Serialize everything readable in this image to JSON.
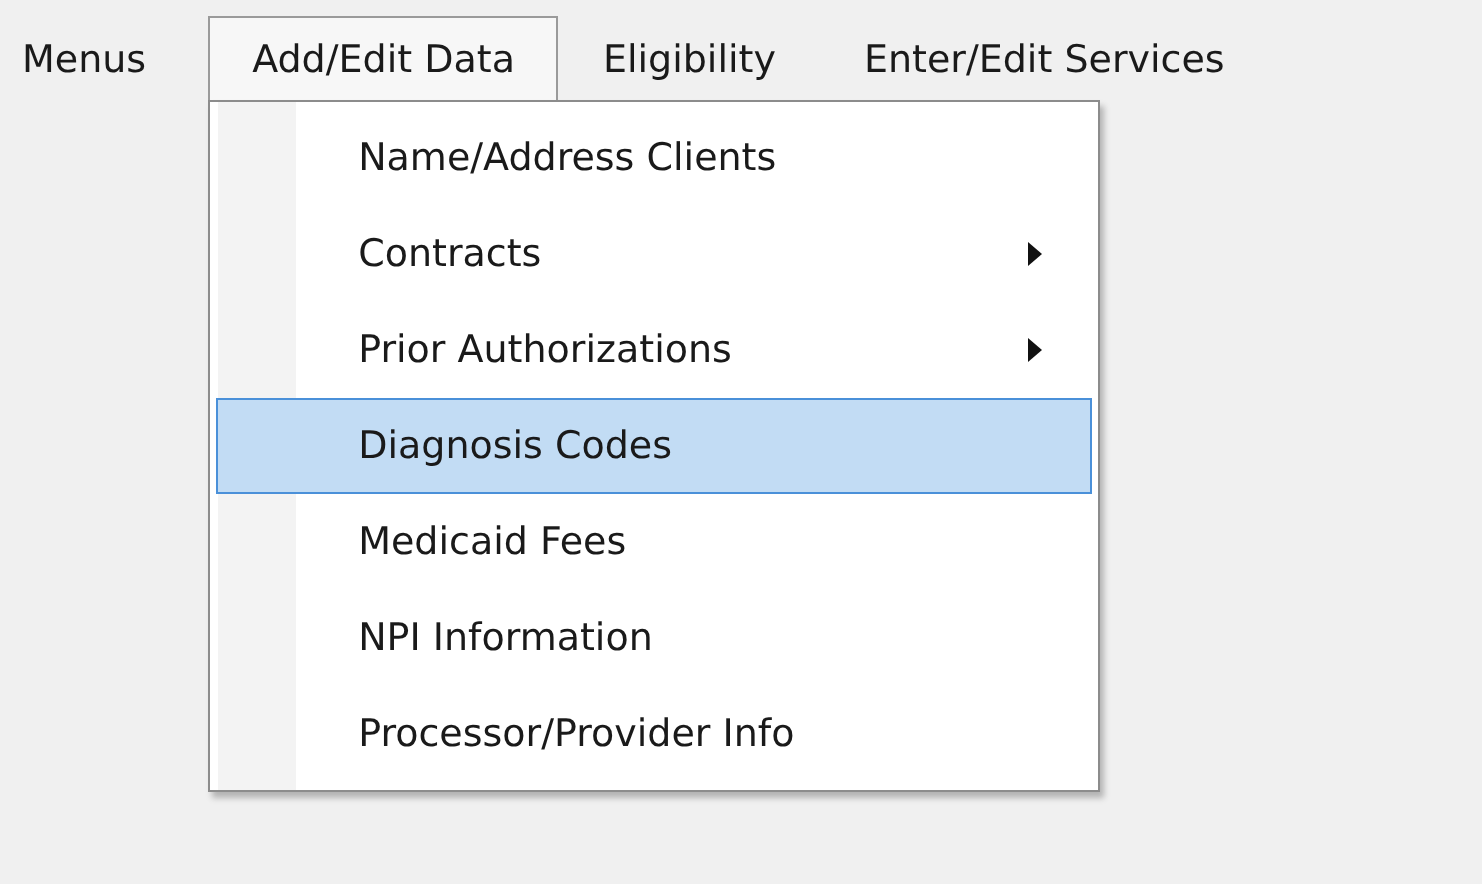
{
  "menu_bar": [
    {
      "label": "Menus",
      "selected": false
    },
    {
      "label": "Add/Edit Data",
      "selected": true,
      "menu": [
        {
          "label": "Name/Address Clients",
          "submenu": false,
          "selected": false
        },
        {
          "label": "Contracts",
          "submenu": true,
          "selected": false
        },
        {
          "label": "Prior Authorizations",
          "submenu": true,
          "selected": false
        },
        {
          "label": "Diagnosis Codes",
          "submenu": false,
          "selected": true
        },
        {
          "label": "Medicaid Fees",
          "submenu": false,
          "selected": false
        },
        {
          "label": "NPI Information",
          "submenu": false,
          "selected": false
        },
        {
          "label": "Processor/Provider Info",
          "submenu": false,
          "selected": false
        }
      ]
    },
    {
      "label": "Eligibility",
      "selected": false
    },
    {
      "label": "Enter/Edit Services",
      "selected": false
    }
  ]
}
